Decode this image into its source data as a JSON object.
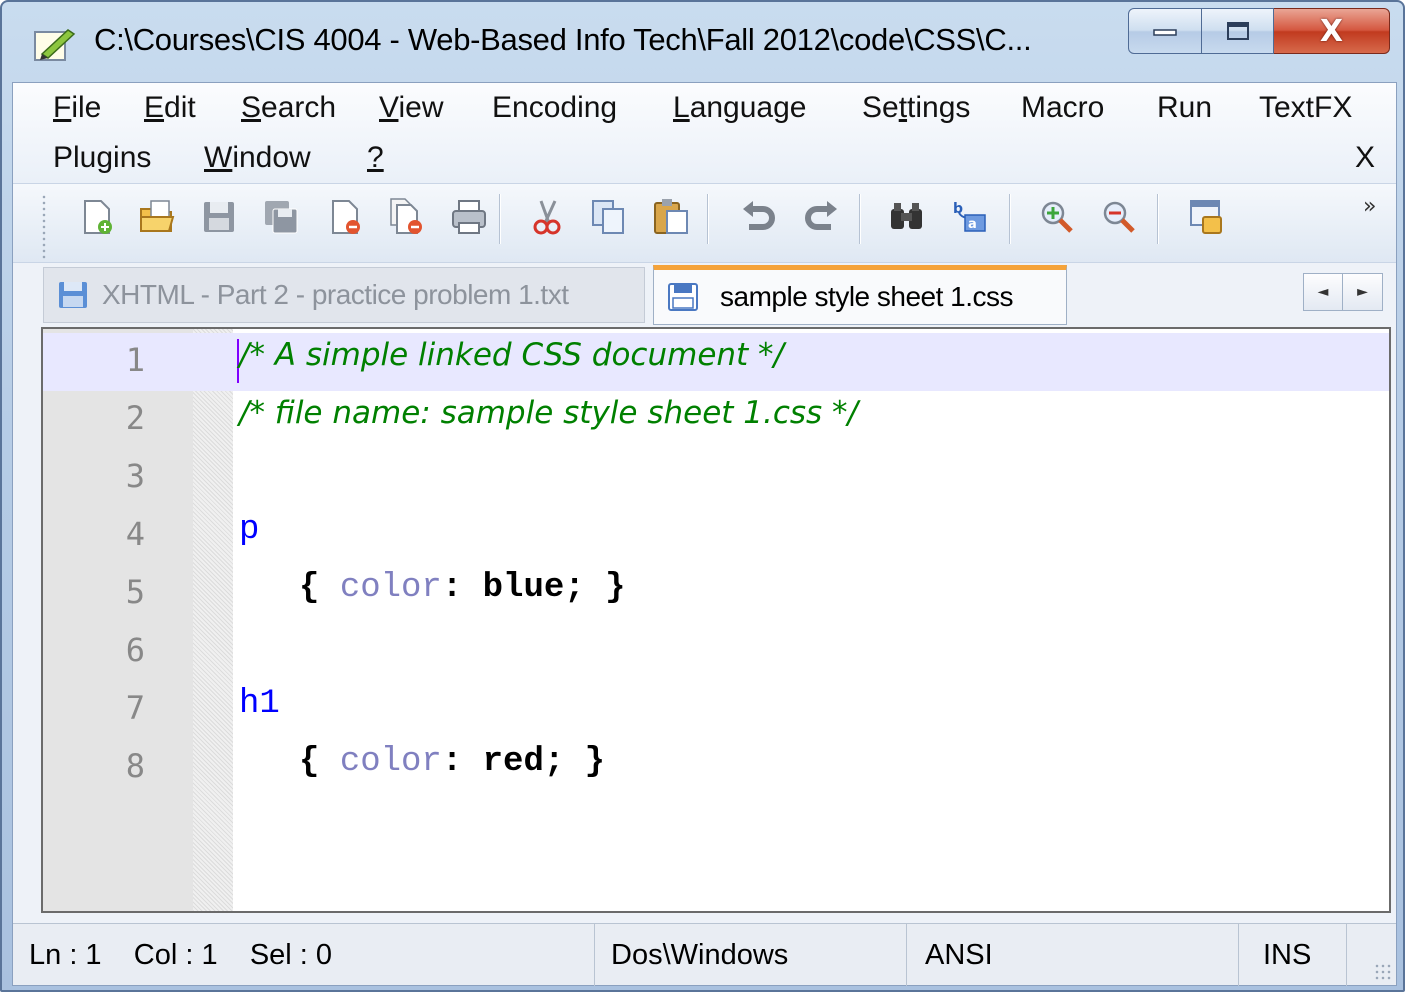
{
  "window": {
    "title": "C:\\Courses\\CIS 4004 - Web-Based Info Tech\\Fall 2012\\code\\CSS\\C...",
    "close_symbol": "X"
  },
  "menubar": {
    "row1": [
      {
        "label": "File",
        "accel": "F",
        "rest": "ile"
      },
      {
        "label": "Edit",
        "accel": "E",
        "rest": "dit"
      },
      {
        "label": "Search",
        "accel": "S",
        "rest": "earch"
      },
      {
        "label": "View",
        "accel": "V",
        "rest": "iew"
      },
      {
        "label": "Encoding"
      },
      {
        "label": "Language",
        "accel": "L",
        "rest": "anguage"
      },
      {
        "label": "Settings",
        "pre": "Se",
        "accel": "t",
        "rest": "tings"
      },
      {
        "label": "Macro"
      },
      {
        "label": "Run"
      },
      {
        "label": "TextFX"
      }
    ],
    "row2": [
      {
        "label": "Plugins"
      },
      {
        "label": "Window",
        "accel": "W",
        "rest": "indow"
      },
      {
        "label": "?",
        "accel": "?"
      }
    ],
    "close_doc": "X"
  },
  "toolbar": {
    "icons": [
      "new-file-icon",
      "open-file-icon",
      "save-icon",
      "save-all-icon",
      "close-icon",
      "close-all-icon",
      "print-icon",
      "cut-icon",
      "copy-icon",
      "paste-icon",
      "undo-icon",
      "redo-icon",
      "find-icon",
      "replace-icon",
      "zoom-in-icon",
      "zoom-out-icon",
      "sync-view-icon"
    ],
    "overflow": "»"
  },
  "tabs": [
    {
      "label": "XHTML - Part 2 - practice problem 1.txt",
      "active": false
    },
    {
      "label": "sample style sheet 1.css",
      "active": true
    }
  ],
  "tab_scroll": {
    "left": "◄",
    "right": "►"
  },
  "editor": {
    "lines": [
      {
        "n": "1",
        "comment": "/* A simple linked CSS document */"
      },
      {
        "n": "2",
        "comment": "/* file name: sample style sheet 1.css */"
      },
      {
        "n": "3"
      },
      {
        "n": "4",
        "selector": "p"
      },
      {
        "n": "5",
        "open": "{ ",
        "prop": "color",
        "colon": ": ",
        "value": "blue;",
        "close": " }"
      },
      {
        "n": "6"
      },
      {
        "n": "7",
        "selector": "h1"
      },
      {
        "n": "8",
        "open": "{ ",
        "prop": "color",
        "colon": ": ",
        "value": "red;",
        "close": " }"
      }
    ],
    "current_line": 1
  },
  "status": {
    "position": "Ln : 1    Col : 1    Sel : 0",
    "eol": "Dos\\Windows",
    "encoding": "ANSI",
    "mode": "INS"
  },
  "colors": {
    "comment": "#008000",
    "selector": "#0000ff",
    "property": "#8080c0",
    "current_line": "#e8e8ff",
    "active_tab_accent": "#f5a33a"
  }
}
